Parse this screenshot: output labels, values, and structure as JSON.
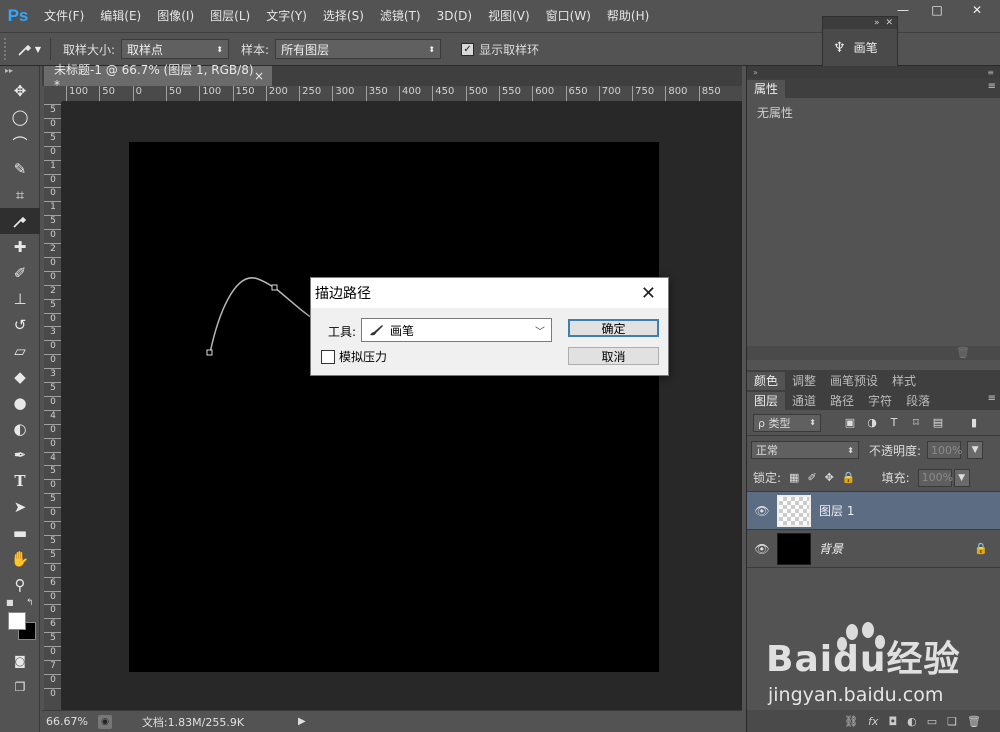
{
  "app": {
    "logo": "Ps"
  },
  "menu": [
    "文件(F)",
    "编辑(E)",
    "图像(I)",
    "图层(L)",
    "文字(Y)",
    "选择(S)",
    "滤镜(T)",
    "3D(D)",
    "视图(V)",
    "窗口(W)",
    "帮助(H)"
  ],
  "window_controls": {
    "minimize": "—",
    "maximize": "□",
    "close": "✕"
  },
  "options": {
    "sample_size_label": "取样大小:",
    "sample_size_value": "取样点",
    "sample_label": "样本:",
    "sample_value": "所有图层",
    "show_ring_label": "显示取样环",
    "show_ring_checked": true
  },
  "brush_mini_panel": {
    "label": "画笔",
    "icon": "brush-icon"
  },
  "tools": [
    "move-tool",
    "elliptical-marquee-tool",
    "polygonal-lasso-tool",
    "quick-selection-tool",
    "crop-tool",
    "eyedropper-tool",
    "spot-healing-tool",
    "brush-tool",
    "clone-stamp-tool",
    "history-brush-tool",
    "eraser-tool",
    "paint-bucket-tool",
    "blur-tool",
    "dodge-tool",
    "pen-tool",
    "type-tool",
    "path-selection-tool",
    "rectangle-tool",
    "hand-tool",
    "zoom-tool"
  ],
  "active_tool": "eyedropper-tool",
  "document": {
    "tab_title": "未标题-1 @ 66.7% (图层 1, RGB/8) *",
    "tab_close": "×",
    "ruler_top": [
      "100",
      "50",
      "0",
      "50",
      "100",
      "150",
      "200",
      "250",
      "300",
      "350",
      "400",
      "450",
      "500",
      "550",
      "600",
      "650",
      "700",
      "750",
      "800",
      "850"
    ],
    "ruler_left": [
      "5",
      "0",
      "5",
      "0",
      "1",
      "0",
      "0",
      "1",
      "5",
      "0",
      "2",
      "0",
      "0",
      "2",
      "5",
      "0",
      "3",
      "0",
      "0",
      "3",
      "5",
      "0",
      "4",
      "0",
      "0",
      "4",
      "5",
      "0",
      "5",
      "0",
      "0",
      "5",
      "5",
      "0",
      "6",
      "0",
      "0",
      "6",
      "5",
      "0",
      "7",
      "0",
      "0"
    ],
    "colors": {
      "canvas": "#000000",
      "pasteboard": "#282828",
      "path_stroke": "#b4b4b4"
    }
  },
  "status": {
    "zoom": "66.67%",
    "doc_info": "文档:1.83M/255.9K",
    "arrow": "▶"
  },
  "properties_panel": {
    "tab": "属性",
    "body": "无属性",
    "menu": "≡"
  },
  "color_panel_tabs": [
    "颜色",
    "调整",
    "画笔预设",
    "样式"
  ],
  "layers_panel": {
    "tabs": [
      "图层",
      "通道",
      "路径",
      "字符",
      "段落"
    ],
    "filter_label": "ρ 类型",
    "blend_mode": "正常",
    "opacity_label": "不透明度:",
    "opacity_value": "100%",
    "lock_label": "锁定:",
    "fill_label": "填充:",
    "fill_value": "100%",
    "layers": [
      {
        "name": "图层 1",
        "selected": true,
        "thumb": "transparent"
      },
      {
        "name": "背景",
        "selected": false,
        "thumb": "black",
        "locked": true
      }
    ],
    "footer_icons": [
      "link-icon",
      "fx-icon",
      "mask-icon",
      "adjustment-icon",
      "group-icon",
      "new-layer-icon",
      "trash-icon"
    ]
  },
  "dialog": {
    "title": "描边路径",
    "tool_label": "工具:",
    "tool_value": "画笔",
    "pressure_label": "模拟压力",
    "pressure_checked": false,
    "ok": "确定",
    "cancel": "取消"
  },
  "watermark": {
    "main": "Baidu经验",
    "url": "jingyan.baidu.com"
  }
}
